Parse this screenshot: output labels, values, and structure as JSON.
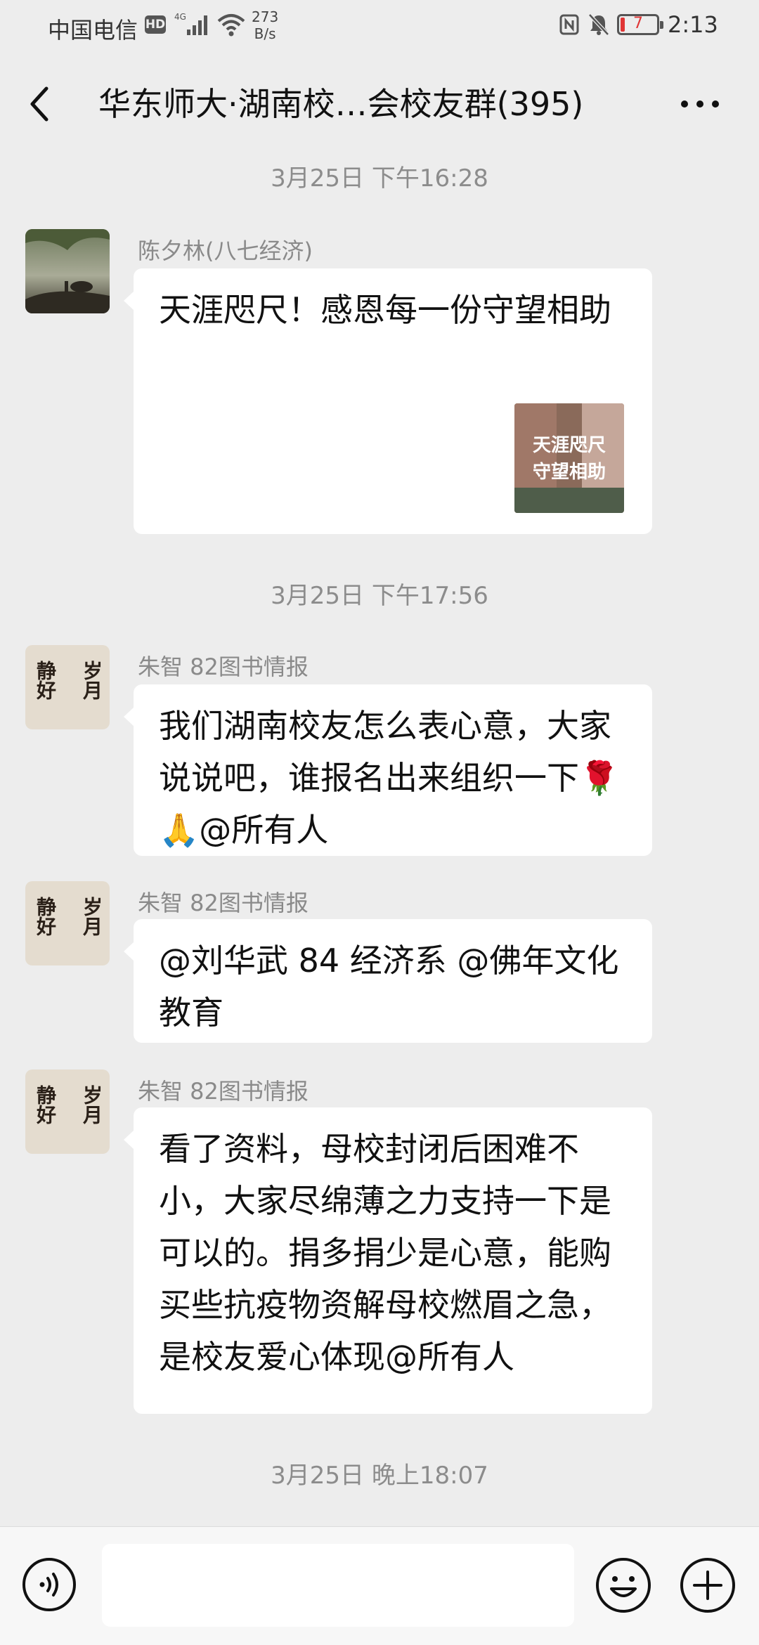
{
  "status_bar": {
    "carrier": "中国电信",
    "hd": "HD",
    "network": "4G",
    "speed_value": "273",
    "speed_unit": "B/s",
    "battery": "7",
    "time": "2:13"
  },
  "header": {
    "title": "华东师大·湖南校…会校友群(395)"
  },
  "timestamps": [
    "3月25日 下午16:28",
    "3月25日 下午17:56",
    "3月25日 晚上18:07"
  ],
  "messages": [
    {
      "sender": "陈夕林(八七经济)",
      "text": "天涯咫尺！感恩每一份守望相助",
      "link_thumb": {
        "line1": "天涯咫尺",
        "line2": "守望相助"
      }
    },
    {
      "sender": "朱智 82图书情报",
      "text": "我们湖南校友怎么表心意，大家说说吧，谁报名出来组织一下🌹🙏@所有人"
    },
    {
      "sender": "朱智 82图书情报",
      "text": "@刘华武 84 经济系 @佛年文化教育"
    },
    {
      "sender": "朱智 82图书情报",
      "text": "看了资料，母校封闭后困难不小，大家尽绵薄之力支持一下是可以的。捐多捐少是心意，能购买些抗疫物资解母校燃眉之急，是校友爱心体现@所有人"
    }
  ],
  "avatar_calligraphy": {
    "left": "静好",
    "right": "岁月"
  },
  "colors": {
    "background": "#ededed",
    "bubble": "#ffffff",
    "timestamp_text": "#8c8c8c",
    "sender_text": "#8a8a8a"
  },
  "icons": [
    "back-icon",
    "more-icon",
    "voice-icon",
    "emoji-icon",
    "plus-icon",
    "signal-icon",
    "wifi-icon",
    "nfc-icon",
    "mute-bell-icon",
    "battery-icon"
  ]
}
